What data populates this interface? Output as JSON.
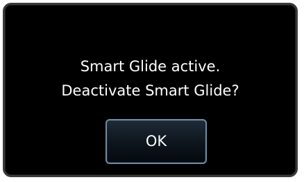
{
  "dialog": {
    "message_line1": "Smart Glide active.",
    "message_line2": "Deactivate Smart Glide?",
    "ok_label": "OK"
  }
}
